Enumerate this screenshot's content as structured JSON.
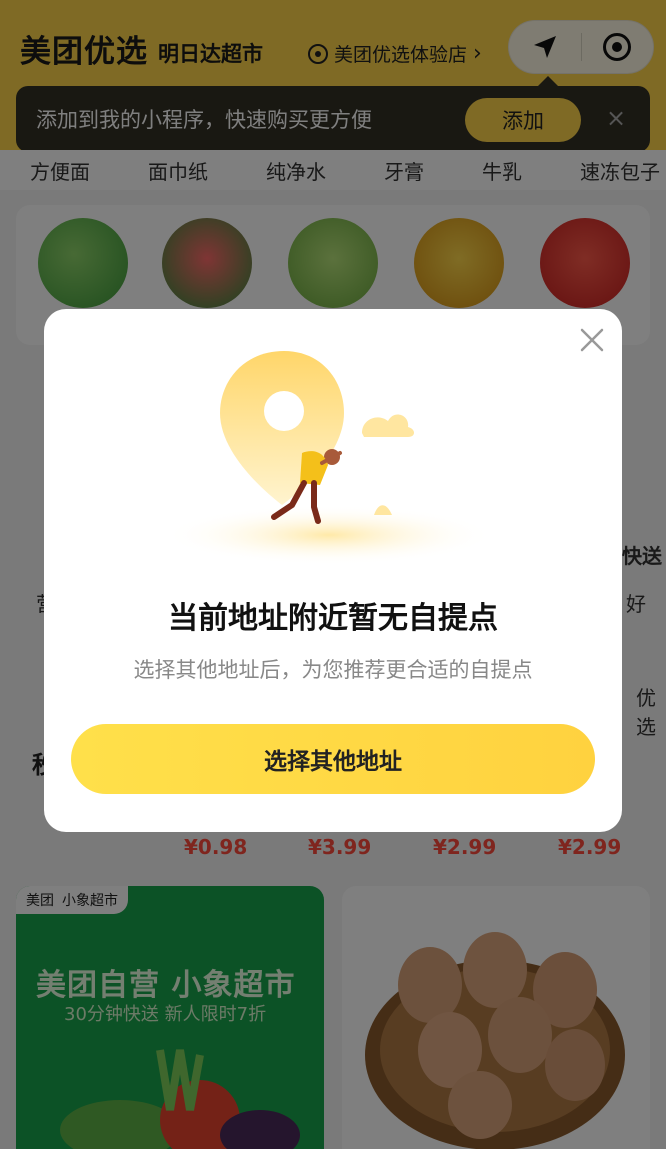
{
  "header": {
    "brand": "美团优选",
    "brand_sub": "明日达超市",
    "store_name": "美团优选体验店"
  },
  "tip": {
    "text": "添加到我的小程序，快速购买更方便",
    "add_label": "添加",
    "close_symbol": "×"
  },
  "tabs": [
    "方便面",
    "面巾纸",
    "纯净水",
    "牙膏",
    "牛乳",
    "速冻包子"
  ],
  "section": {
    "title": "秒",
    "prices": [
      "¥0.98",
      "¥3.99",
      "¥2.99",
      "¥2.99"
    ]
  },
  "side_text": {
    "left": "营",
    "right_top": "快送",
    "right_mid": "好",
    "right_bottom": "优选"
  },
  "promo": {
    "badge_meituan": "美团",
    "badge_xiaoxiang": "小象超市",
    "title": "美团自营 小象超市",
    "subtitle": "30分钟快送 新人限时7折"
  },
  "modal": {
    "title": "当前地址附近暂无自提点",
    "subtitle": "选择其他地址后，为您推荐更合适的自提点",
    "button_label": "选择其他地址"
  },
  "colors": {
    "brand_yellow": "#ffd54a",
    "price_red": "#ff4a3d",
    "promo_green": "#19a44c"
  }
}
